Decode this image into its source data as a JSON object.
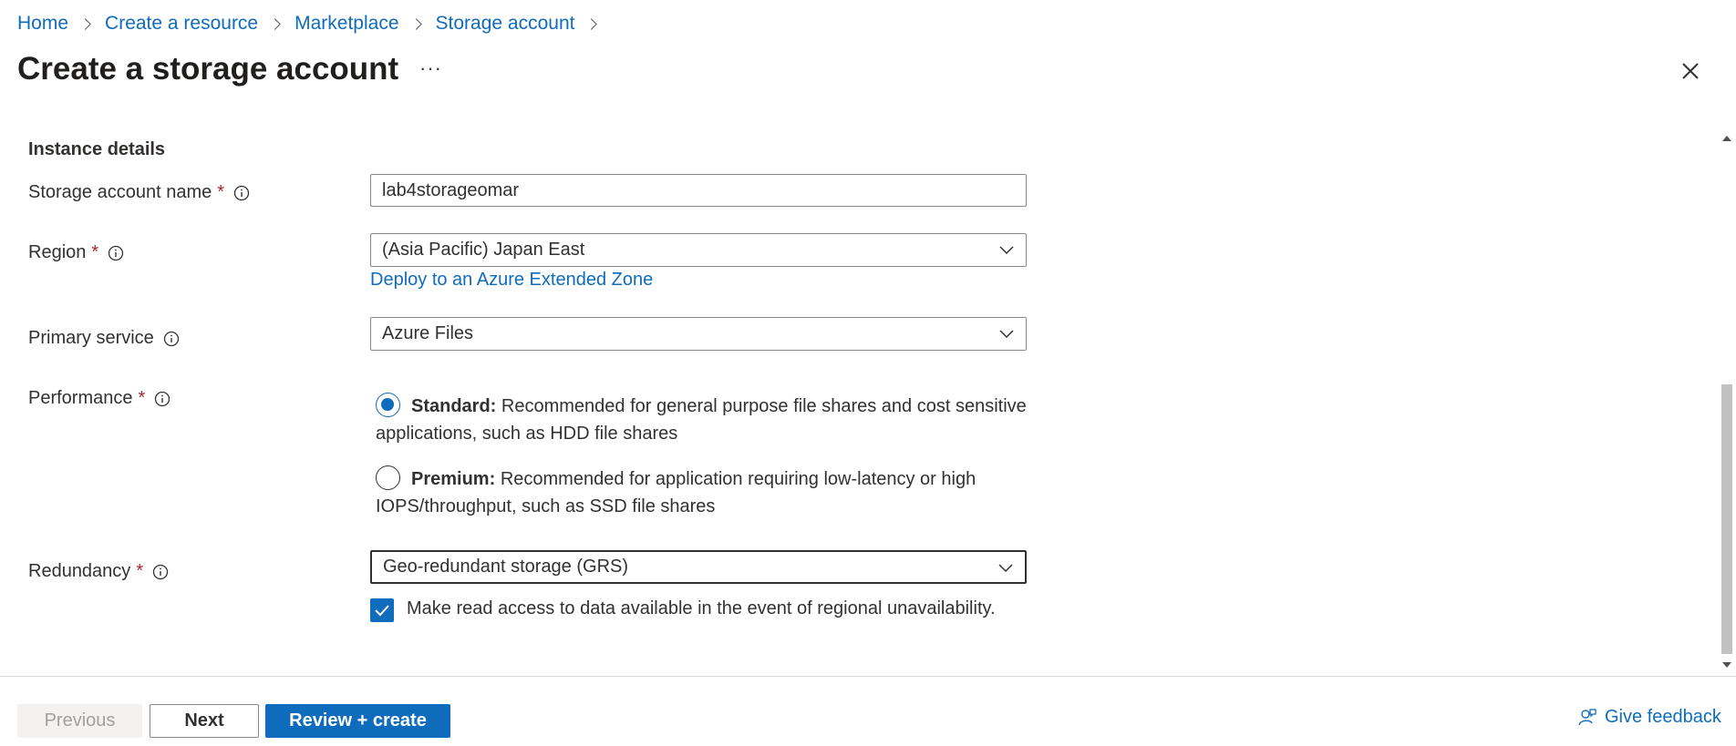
{
  "breadcrumb": {
    "items": [
      "Home",
      "Create a resource",
      "Marketplace",
      "Storage account"
    ]
  },
  "header": {
    "title": "Create a storage account",
    "more_label": "···"
  },
  "section": {
    "title": "Instance details"
  },
  "fields": {
    "storage_account_name": {
      "label": "Storage account name",
      "required_mark": "*",
      "value": "lab4storageomar"
    },
    "region": {
      "label": "Region",
      "required_mark": "*",
      "value": "(Asia Pacific) Japan East",
      "link": "Deploy to an Azure Extended Zone"
    },
    "primary_service": {
      "label": "Primary service",
      "value": "Azure Files"
    },
    "performance": {
      "label": "Performance",
      "required_mark": "*",
      "options": [
        {
          "title": "Standard:",
          "description": "Recommended for general purpose file shares and cost sensitive applications, such as HDD file shares",
          "selected": true
        },
        {
          "title": "Premium:",
          "description": "Recommended for application requiring low-latency or high IOPS/throughput, such as SSD file shares",
          "selected": false
        }
      ]
    },
    "redundancy": {
      "label": "Redundancy",
      "required_mark": "*",
      "value": "Geo-redundant storage (GRS)",
      "checkbox_label": "Make read access to data available in the event of regional unavailability.",
      "checkbox_checked": true
    }
  },
  "footer": {
    "previous_label": "Previous",
    "next_label": "Next",
    "review_label": "Review + create",
    "feedback_label": "Give feedback"
  },
  "colors": {
    "accent": "#0f6cbd",
    "required": "#a4262c",
    "text": "#323130"
  }
}
